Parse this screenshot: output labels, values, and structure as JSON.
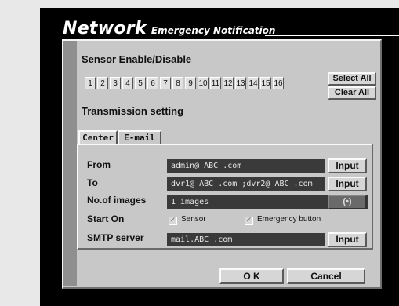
{
  "header": {
    "title": "Network",
    "subtitle": "Emergency Notification"
  },
  "sensor_section": {
    "label": "Sensor Enable/Disable",
    "sensors": [
      "1",
      "2",
      "3",
      "4",
      "5",
      "6",
      "7",
      "8",
      "9",
      "10",
      "11",
      "12",
      "13",
      "14",
      "15",
      "16"
    ],
    "select_all": "Select All",
    "clear_all": "Clear All"
  },
  "transmission": {
    "label": "Transmission setting",
    "tabs": [
      "Center",
      "E-mail"
    ],
    "active_tab": "E-mail"
  },
  "form": {
    "from": {
      "label": "From",
      "value": "admin@ ABC .com",
      "button": "Input"
    },
    "to": {
      "label": "To",
      "value": "dvr1@ ABC .com ;dvr2@ ABC .com",
      "button": "Input"
    },
    "images": {
      "label": "No.of images",
      "value": "1 images",
      "spinner": "(•)"
    },
    "start_on": {
      "label": "Start On",
      "sensor_label": "Sensor",
      "sensor_checked": true,
      "emergency_label": "Emergency button",
      "emergency_checked": true
    },
    "smtp": {
      "label": "SMTP server",
      "value": "mail.ABC .com",
      "button": "Input"
    }
  },
  "footer": {
    "ok": "O K",
    "cancel": "Cancel"
  }
}
